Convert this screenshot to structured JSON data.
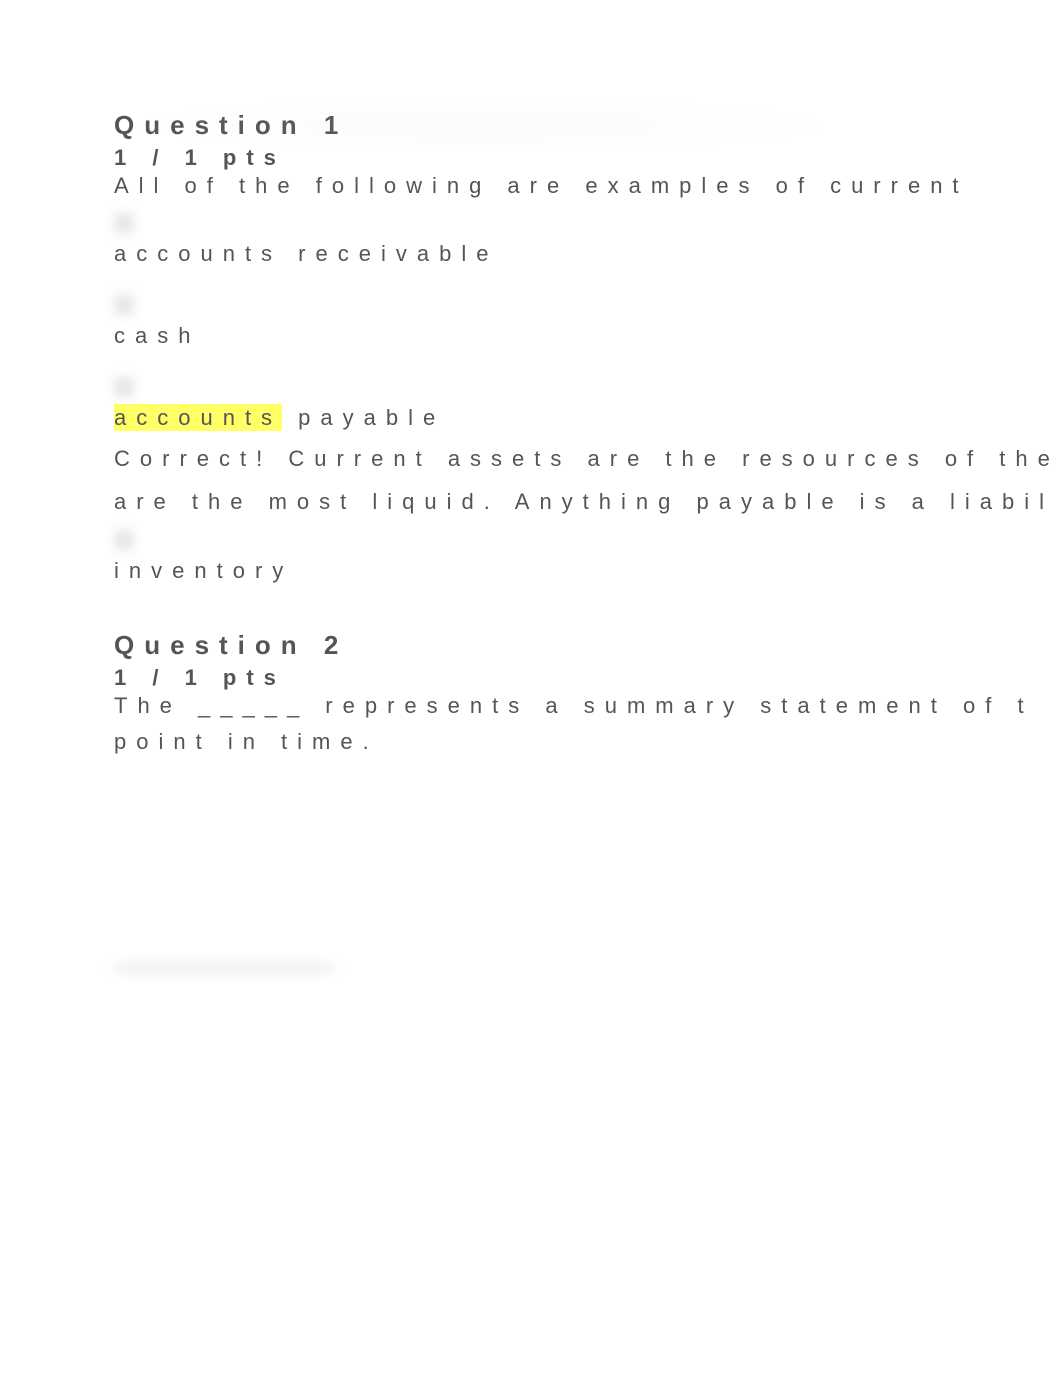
{
  "q1": {
    "title": "Question 1",
    "pts": "1 / 1 pts",
    "stem": "All of the following are examples of current",
    "optA": "accounts receivable",
    "optB": "cash",
    "optC_hl": "accounts",
    "optC_rest": " payable",
    "feedback_l1": "Correct! Current assets are the resources of the",
    "feedback_l2": "are the most liquid. Anything payable is a liabil",
    "optD": "inventory"
  },
  "q2": {
    "title": "Question 2",
    "pts": "1 / 1 pts",
    "stem_l1": "The _____ represents a summary statement of t",
    "stem_l2": "point in time."
  }
}
